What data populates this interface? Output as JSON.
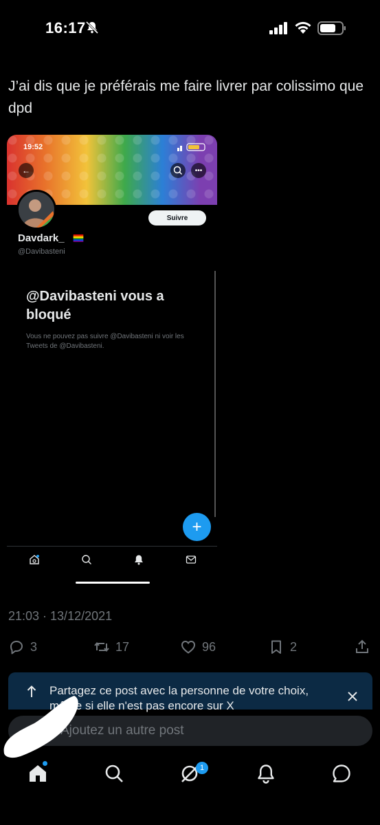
{
  "status_bar": {
    "time": "16:17"
  },
  "tweet": {
    "text": "J’ai dis que je préférais me faire livrer par colissimo que dpd",
    "timestamp": "21:03 · 13/12/2021",
    "replies": "3",
    "retweets": "17",
    "likes": "96",
    "bookmarks": "2"
  },
  "embedded_screenshot": {
    "time": "19:52",
    "follow_label": "Suivre",
    "name": "Davdark_",
    "handle": "@Davibasteni",
    "blocked_title": "@Davibasteni vous a bloqué",
    "blocked_subtitle": "Vous ne pouvez pas suivre @Davibasteni ni voir les Tweets de @Davibasteni."
  },
  "share_banner": {
    "text": "Partagez ce post avec la personne de votre choix, même si elle n'est pas encore sur X"
  },
  "reply": {
    "placeholder": "Ajoutez un autre post"
  },
  "nav": {
    "badge": "1"
  },
  "colors": {
    "accent": "#1d9bf0",
    "background": "#000000",
    "muted": "#71767b"
  }
}
